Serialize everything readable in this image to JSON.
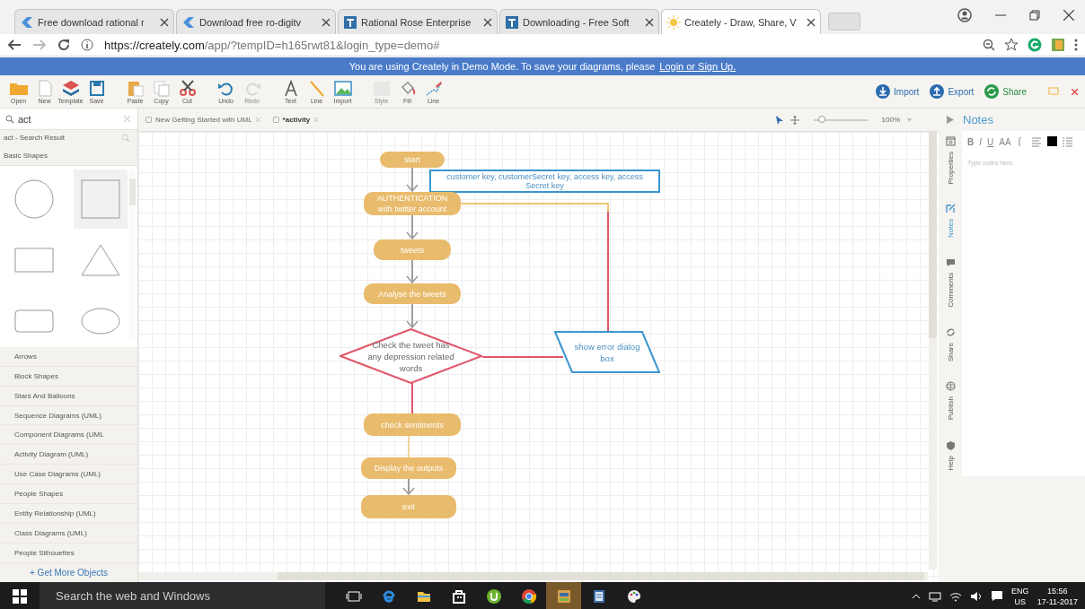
{
  "browser": {
    "tabs": [
      {
        "title": "Free download rational r",
        "selected": false
      },
      {
        "title": "Download free ro-digitv",
        "selected": false
      },
      {
        "title": "Rational Rose Enterprise",
        "selected": false
      },
      {
        "title": "Downloading - Free Soft",
        "selected": false
      },
      {
        "title": "Creately - Draw, Share, V",
        "selected": true
      }
    ],
    "url_host": "https://creately.com",
    "url_path": "/app/?tempID=h165rwt81&login_type=demo#"
  },
  "demo_banner": {
    "text": "You are using Creately in Demo Mode. To save your diagrams, please",
    "link": "Login or Sign Up."
  },
  "toolbar": {
    "tools": [
      {
        "label": "Open",
        "disabled": false
      },
      {
        "label": "New",
        "disabled": false
      },
      {
        "label": "Template",
        "disabled": false
      },
      {
        "label": "Save",
        "disabled": false
      },
      {
        "label": "Paste",
        "disabled": false
      },
      {
        "label": "Copy",
        "disabled": false
      },
      {
        "label": "Cut",
        "disabled": false
      },
      {
        "label": "Undo",
        "disabled": false
      },
      {
        "label": "Redo",
        "disabled": true
      },
      {
        "label": "Text",
        "disabled": false
      },
      {
        "label": "Line",
        "disabled": false
      },
      {
        "label": "Import",
        "disabled": false
      },
      {
        "label": "Style",
        "disabled": true
      },
      {
        "label": "Fill",
        "disabled": false
      },
      {
        "label": "Line",
        "disabled": false
      }
    ],
    "actions": [
      {
        "label": "Import",
        "kind": "import"
      },
      {
        "label": "Export",
        "kind": "export"
      },
      {
        "label": "Share",
        "kind": "share"
      }
    ]
  },
  "shape_library": {
    "search": {
      "value": "act"
    },
    "result_title": "act - Search Result",
    "section": "Basic Shapes",
    "shapes": [
      {
        "kind": "circle",
        "selected": false
      },
      {
        "kind": "square",
        "selected": true
      },
      {
        "kind": "rectangle",
        "selected": false
      },
      {
        "kind": "triangle",
        "selected": false
      },
      {
        "kind": "rounded",
        "selected": false
      },
      {
        "kind": "ellipse",
        "selected": false
      }
    ],
    "categories": [
      "Arrows",
      "Block Shapes",
      "Stars And Balloons",
      "Sequence Diagrams (UML)",
      "Component Diagrams (UML",
      "Activity Diagram (UML)",
      "Use Case Diagrams (UML)",
      "People Shapes",
      "Entity Relationship (UML)",
      "Class Diagrams (UML)",
      "People Silhouettes"
    ],
    "more_link": "+ Get More Objects"
  },
  "document": {
    "tabs": [
      {
        "title": "New Getting Started with UML",
        "selected": false
      },
      {
        "title": "*activity",
        "selected": true
      }
    ],
    "zoom": {
      "level": 0.1,
      "value": "100%"
    }
  },
  "diagram": {
    "nodes": [
      {
        "kind": "activity",
        "text": "start"
      },
      {
        "kind": "note",
        "text": "customer key, customerSecret key, access key, access Secret key"
      },
      {
        "kind": "activity",
        "text": "AUTHENTICATION with twitter account"
      },
      {
        "kind": "activity",
        "text": "tweets"
      },
      {
        "kind": "activity",
        "text": "Analyse the tweets"
      },
      {
        "kind": "decision",
        "text": "Check the tweet has any depression related words"
      },
      {
        "kind": "io",
        "text": "show error dialog box"
      },
      {
        "kind": "activity",
        "text": "check sentiments"
      },
      {
        "kind": "activity",
        "text": "Display the outputs"
      },
      {
        "kind": "activity",
        "text": "exit"
      }
    ],
    "connectors": [
      {
        "kind": "arrow",
        "color": "#9e9e9e"
      },
      {
        "kind": "arrow",
        "color": "#9e9e9e"
      },
      {
        "kind": "arrow",
        "color": "#9e9e9e"
      },
      {
        "kind": "arrow",
        "color": "#9e9e9e"
      },
      {
        "kind": "line",
        "color": "#f0c674"
      },
      {
        "kind": "line",
        "color": "#e0566a"
      },
      {
        "kind": "line",
        "color": "#e0566a"
      },
      {
        "kind": "line",
        "color": "#e0566a"
      },
      {
        "kind": "line",
        "color": "#f0d49a"
      },
      {
        "kind": "arrow",
        "color": "#9e9e9e"
      }
    ]
  },
  "notes_panel": {
    "title": "Notes",
    "format_buttons": [
      "B",
      "I",
      "U",
      "AA"
    ],
    "placeholder": "Type notes here.",
    "side_tabs": [
      {
        "label": "Properties",
        "selected": false
      },
      {
        "label": "Notes",
        "selected": true
      },
      {
        "label": "Comments",
        "selected": false
      },
      {
        "label": "Share",
        "selected": false
      },
      {
        "label": "Publish",
        "selected": false
      },
      {
        "label": "Help",
        "selected": false
      }
    ]
  },
  "taskbar": {
    "search_placeholder": "Search the web and Windows",
    "language": "ENG",
    "region": "US",
    "time": "15:56",
    "date": "17-11-2017"
  }
}
